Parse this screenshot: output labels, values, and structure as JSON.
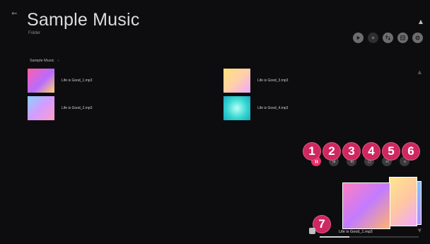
{
  "header": {
    "title": "Sample Music",
    "subtitle": "Folder"
  },
  "toolbar": {
    "icons": [
      "play-icon",
      "select-icon",
      "sort-icon",
      "filter-icon",
      "settings-icon"
    ]
  },
  "section": {
    "label": "Sample Music",
    "chevron": "›"
  },
  "tracks": [
    {
      "name": "Life is Good_1.mp3",
      "art": "pink"
    },
    {
      "name": "Life is Good_2.mp3",
      "art": "lilac"
    },
    {
      "name": "Life is Good_3.mp3",
      "art": "yellow"
    },
    {
      "name": "Life is Good_4.mp3",
      "art": "teal"
    }
  ],
  "player": {
    "controls": [
      "play-pause-icon",
      "previous-icon",
      "next-icon",
      "repeat-icon",
      "shuffle-icon",
      "close-icon"
    ],
    "now_playing": "Life is Good_1.mp3",
    "progress_fraction": 0.3
  },
  "callouts": [
    "1",
    "2",
    "3",
    "4",
    "5",
    "6",
    "7"
  ],
  "colors": {
    "accent": "#ee2f6b",
    "badge": "#cf2760",
    "background": "#0d0d0f"
  }
}
